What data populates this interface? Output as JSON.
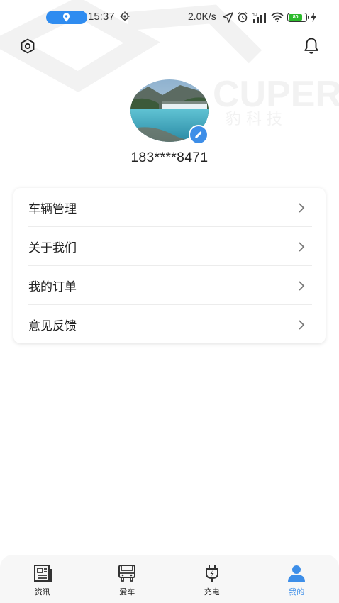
{
  "status_bar": {
    "time": "15:37",
    "net_speed": "2.0K/s",
    "battery": "80",
    "icons": [
      "location-icon",
      "settings-small-icon",
      "navigation-icon",
      "alarm-icon",
      "hd-signal-icon",
      "wifi-icon",
      "battery-icon",
      "charging-icon"
    ]
  },
  "header": {
    "left_icon": "settings-hex-icon",
    "right_icon": "bell-icon"
  },
  "profile": {
    "phone": "183****8471",
    "edit_icon": "pencil-icon"
  },
  "watermark": {
    "text_latin": "CUPERE",
    "text_cjk": "豹 科 技"
  },
  "menu": {
    "items": [
      {
        "label": "车辆管理"
      },
      {
        "label": "关于我们"
      },
      {
        "label": "我的订单"
      },
      {
        "label": "意见反馈"
      }
    ]
  },
  "colors": {
    "accent": "#3d8ee8",
    "text": "#222222",
    "nav_bg": "#f7f7f7"
  },
  "bottom_nav": {
    "items": [
      {
        "label": "资讯",
        "icon": "news-icon"
      },
      {
        "label": "爱车",
        "icon": "car-icon"
      },
      {
        "label": "充电",
        "icon": "plug-icon"
      },
      {
        "label": "我的",
        "icon": "user-icon",
        "active": true
      }
    ]
  }
}
